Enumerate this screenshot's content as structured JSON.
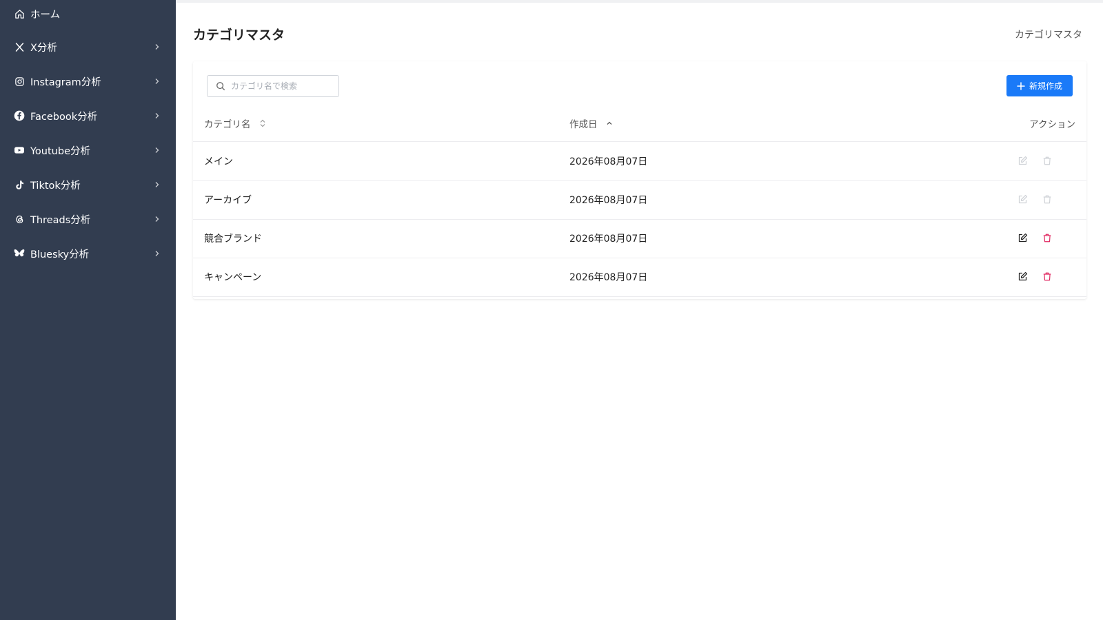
{
  "sidebar": {
    "items": [
      {
        "label": "ホーム",
        "icon": "home-icon",
        "has_chevron": false
      },
      {
        "label": "X分析",
        "icon": "x-logo-icon",
        "has_chevron": true
      },
      {
        "label": "Instagram分析",
        "icon": "instagram-icon",
        "has_chevron": true
      },
      {
        "label": "Facebook分析",
        "icon": "facebook-icon",
        "has_chevron": true
      },
      {
        "label": "Youtube分析",
        "icon": "youtube-icon",
        "has_chevron": true
      },
      {
        "label": "Tiktok分析",
        "icon": "tiktok-icon",
        "has_chevron": true
      },
      {
        "label": "Threads分析",
        "icon": "threads-icon",
        "has_chevron": true
      },
      {
        "label": "Bluesky分析",
        "icon": "bluesky-icon",
        "has_chevron": true
      }
    ]
  },
  "header": {
    "title": "カテゴリマスタ",
    "breadcrumb": "カテゴリマスタ"
  },
  "toolbar": {
    "search_placeholder": "カテゴリ名で検索",
    "search_value": "",
    "new_label": "新規作成"
  },
  "table": {
    "columns": {
      "name": "カテゴリ名",
      "created": "作成日",
      "actions": "アクション"
    },
    "rows": [
      {
        "name": "メイン",
        "created": "2026年08月07日",
        "actions_enabled": false
      },
      {
        "name": "アーカイブ",
        "created": "2026年08月07日",
        "actions_enabled": false
      },
      {
        "name": "競合ブランド",
        "created": "2026年08月07日",
        "actions_enabled": true
      },
      {
        "name": "キャンペーン",
        "created": "2026年08月07日",
        "actions_enabled": true
      }
    ]
  },
  "colors": {
    "sidebar_bg": "#323d50",
    "primary": "#1a7af8",
    "danger": "#e0245e",
    "disabled_icon": "#cfd2d7",
    "edit_icon": "#222222"
  }
}
